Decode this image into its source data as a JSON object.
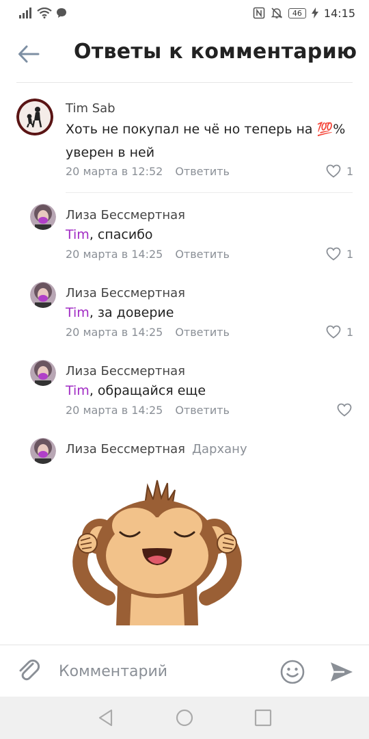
{
  "status_bar": {
    "battery": "46",
    "time": "14:15"
  },
  "header": {
    "title": "Ответы к комментарию"
  },
  "parent_comment": {
    "author": "Tim Sab",
    "text_before": "Хоть не покупал не чё но теперь на ",
    "emoji": "💯",
    "text_after": "%",
    "text_line2": "уверен в ней",
    "date": "20 марта в 12:52",
    "reply_label": "Ответить",
    "likes": "1"
  },
  "replies": [
    {
      "author": "Лиза Бессмертная",
      "mention": "Tim",
      "text": ", спасибо",
      "date": "20 марта в 14:25",
      "reply_label": "Ответить",
      "likes": "1"
    },
    {
      "author": "Лиза Бессмертная",
      "mention": "Tim",
      "text": ", за доверие",
      "date": "20 марта в 14:25",
      "reply_label": "Ответить",
      "likes": "1"
    },
    {
      "author": "Лиза Бессмертная",
      "mention": "Tim",
      "text": ", обращайся еще",
      "date": "20 марта в 14:25",
      "reply_label": "Ответить",
      "likes": ""
    },
    {
      "author": "Лиза Бессмертная",
      "reply_to": "Дархану"
    }
  ],
  "composer": {
    "placeholder": "Комментарий"
  },
  "colors": {
    "mention": "#a12cc4",
    "muted": "#8a8f96",
    "icon": "#7d8fa3"
  }
}
